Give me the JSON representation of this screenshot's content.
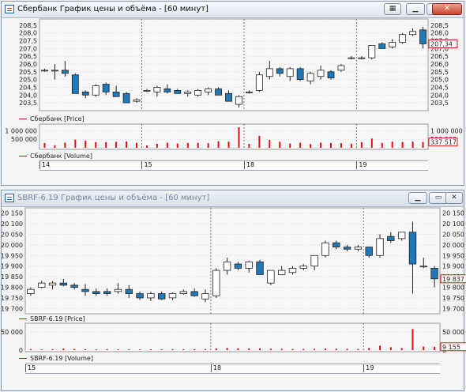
{
  "window1": {
    "title": "Сбербанк График цены и объёма - [60 минут]",
    "price_legend": "Сбербанк [Price]",
    "volume_legend": "Сбербанк [Volume]",
    "price_tag": "207,34",
    "volume_tag": "337 517",
    "price_ticks": [
      "208,5",
      "208,0",
      "207,5",
      "207,0",
      "206,5",
      "206,0",
      "205,5",
      "205,0",
      "204,5",
      "204,0",
      "203,5"
    ],
    "volume_ticks": [
      "1 000 000",
      "500 000"
    ],
    "date_labels": [
      "14",
      "15",
      "18",
      "19"
    ]
  },
  "window2": {
    "title": "SBRF-6.19 График цены и объёма - [60 минут]",
    "price_legend": "SBRF-6.19 [Price]",
    "volume_legend": "SBRF-6.19 [Volume]",
    "price_tag": "19 837",
    "volume_tag": "9 155",
    "price_ticks": [
      "20 150",
      "20 100",
      "20 050",
      "20 000",
      "19 950",
      "19 900",
      "19 850",
      "19 800",
      "19 750",
      "19 700"
    ],
    "volume_ticks": [
      "50 000",
      "0"
    ],
    "date_labels": [
      "15",
      "18",
      "19"
    ]
  },
  "colors": {
    "up": "#ffffff",
    "down": "#1f78b8",
    "volume": "#e01010",
    "grid": "#8a8a8a"
  },
  "chart_data": [
    {
      "type": "candlestick",
      "title": "Сбербанк [Price]",
      "ylim": [
        203.2,
        208.7
      ],
      "grid": true,
      "candles": [
        {
          "o": 205.6,
          "h": 205.7,
          "l": 205.5,
          "c": 205.6
        },
        {
          "o": 205.6,
          "h": 206.0,
          "l": 205.0,
          "c": 205.6
        },
        {
          "o": 205.6,
          "h": 206.2,
          "l": 205.2,
          "c": 205.4
        },
        {
          "o": 205.3,
          "h": 205.4,
          "l": 204.1,
          "c": 204.1
        },
        {
          "o": 204.2,
          "h": 204.3,
          "l": 203.8,
          "c": 204.0
        },
        {
          "o": 204.0,
          "h": 204.7,
          "l": 203.9,
          "c": 204.6
        },
        {
          "o": 204.7,
          "h": 204.8,
          "l": 204.0,
          "c": 204.2
        },
        {
          "o": 204.2,
          "h": 204.6,
          "l": 203.9,
          "c": 203.9
        },
        {
          "o": 204.1,
          "h": 204.2,
          "l": 203.5,
          "c": 203.5
        },
        {
          "o": 203.6,
          "h": 203.8,
          "l": 203.5,
          "c": 203.7
        },
        {
          "o": 204.3,
          "h": 204.4,
          "l": 204.2,
          "c": 204.3
        },
        {
          "o": 204.2,
          "h": 204.6,
          "l": 203.9,
          "c": 204.5
        },
        {
          "o": 204.4,
          "h": 204.7,
          "l": 204.1,
          "c": 204.2
        },
        {
          "o": 204.3,
          "h": 204.4,
          "l": 204.1,
          "c": 204.1
        },
        {
          "o": 204.1,
          "h": 204.3,
          "l": 203.9,
          "c": 204.2
        },
        {
          "o": 204.0,
          "h": 204.4,
          "l": 203.9,
          "c": 204.3
        },
        {
          "o": 204.2,
          "h": 204.5,
          "l": 204.0,
          "c": 204.4
        },
        {
          "o": 204.4,
          "h": 204.5,
          "l": 204.0,
          "c": 204.0
        },
        {
          "o": 204.1,
          "h": 204.3,
          "l": 203.6,
          "c": 203.6
        },
        {
          "o": 203.4,
          "h": 204.0,
          "l": 203.2,
          "c": 203.9
        },
        {
          "o": 204.2,
          "h": 204.3,
          "l": 204.1,
          "c": 204.2
        },
        {
          "o": 204.3,
          "h": 205.5,
          "l": 204.2,
          "c": 205.3
        },
        {
          "o": 205.2,
          "h": 206.2,
          "l": 205.0,
          "c": 205.7
        },
        {
          "o": 205.7,
          "h": 205.8,
          "l": 205.2,
          "c": 205.4
        },
        {
          "o": 205.2,
          "h": 205.8,
          "l": 204.9,
          "c": 205.7
        },
        {
          "o": 205.7,
          "h": 205.8,
          "l": 204.9,
          "c": 205.0
        },
        {
          "o": 204.9,
          "h": 205.5,
          "l": 204.7,
          "c": 205.4
        },
        {
          "o": 205.2,
          "h": 205.9,
          "l": 205.0,
          "c": 205.6
        },
        {
          "o": 205.5,
          "h": 205.6,
          "l": 205.0,
          "c": 205.1
        },
        {
          "o": 205.6,
          "h": 206.0,
          "l": 205.5,
          "c": 205.9
        },
        {
          "o": 206.4,
          "h": 206.5,
          "l": 206.3,
          "c": 206.4
        },
        {
          "o": 206.4,
          "h": 206.5,
          "l": 206.3,
          "c": 206.4
        },
        {
          "o": 206.4,
          "h": 207.2,
          "l": 206.3,
          "c": 207.2
        },
        {
          "o": 207.3,
          "h": 207.4,
          "l": 207.0,
          "c": 207.0
        },
        {
          "o": 207.1,
          "h": 207.6,
          "l": 207.0,
          "c": 207.4
        },
        {
          "o": 207.4,
          "h": 208.0,
          "l": 207.3,
          "c": 207.9
        },
        {
          "o": 207.9,
          "h": 208.3,
          "l": 207.8,
          "c": 208.1
        },
        {
          "o": 208.2,
          "h": 208.4,
          "l": 207.0,
          "c": 207.3
        }
      ],
      "volume": {
        "ylim": [
          0,
          1200000
        ],
        "values": [
          280000,
          150000,
          300000,
          480000,
          420000,
          330000,
          330000,
          350000,
          370000,
          290000,
          140000,
          230000,
          300000,
          250000,
          280000,
          290000,
          270000,
          380000,
          360000,
          1200000,
          230000,
          700000,
          460000,
          350000,
          250000,
          300000,
          220000,
          300000,
          280000,
          270000,
          240000,
          330000,
          540000,
          290000,
          360000,
          340000,
          360000,
          337517
        ]
      }
    },
    {
      "type": "candlestick",
      "title": "SBRF-6.19 [Price]",
      "ylim": [
        19690,
        20160
      ],
      "grid": true,
      "candles": [
        {
          "o": 19770,
          "h": 19800,
          "l": 19760,
          "c": 19790
        },
        {
          "o": 19800,
          "h": 19830,
          "l": 19795,
          "c": 19820
        },
        {
          "o": 19810,
          "h": 19830,
          "l": 19790,
          "c": 19820
        },
        {
          "o": 19820,
          "h": 19840,
          "l": 19805,
          "c": 19810
        },
        {
          "o": 19810,
          "h": 19820,
          "l": 19790,
          "c": 19800
        },
        {
          "o": 19790,
          "h": 19815,
          "l": 19760,
          "c": 19780
        },
        {
          "o": 19780,
          "h": 19795,
          "l": 19760,
          "c": 19770
        },
        {
          "o": 19780,
          "h": 19795,
          "l": 19760,
          "c": 19770
        },
        {
          "o": 19780,
          "h": 19820,
          "l": 19770,
          "c": 19790
        },
        {
          "o": 19790,
          "h": 19810,
          "l": 19750,
          "c": 19770
        },
        {
          "o": 19770,
          "h": 19780,
          "l": 19740,
          "c": 19750
        },
        {
          "o": 19750,
          "h": 19780,
          "l": 19735,
          "c": 19770
        },
        {
          "o": 19770,
          "h": 19780,
          "l": 19740,
          "c": 19745
        },
        {
          "o": 19750,
          "h": 19775,
          "l": 19740,
          "c": 19770
        },
        {
          "o": 19770,
          "h": 19790,
          "l": 19765,
          "c": 19780
        },
        {
          "o": 19780,
          "h": 19795,
          "l": 19755,
          "c": 19760
        },
        {
          "o": 19745,
          "h": 19790,
          "l": 19730,
          "c": 19770
        },
        {
          "o": 19760,
          "h": 19890,
          "l": 19750,
          "c": 19880
        },
        {
          "o": 19880,
          "h": 19940,
          "l": 19860,
          "c": 19920
        },
        {
          "o": 19910,
          "h": 19920,
          "l": 19880,
          "c": 19890
        },
        {
          "o": 19890,
          "h": 19925,
          "l": 19870,
          "c": 19920
        },
        {
          "o": 19920,
          "h": 19930,
          "l": 19860,
          "c": 19860
        },
        {
          "o": 19820,
          "h": 19880,
          "l": 19810,
          "c": 19880
        },
        {
          "o": 19860,
          "h": 19900,
          "l": 19860,
          "c": 19880
        },
        {
          "o": 19870,
          "h": 19900,
          "l": 19860,
          "c": 19890
        },
        {
          "o": 19890,
          "h": 19910,
          "l": 19880,
          "c": 19900
        },
        {
          "o": 19900,
          "h": 19950,
          "l": 19880,
          "c": 19950
        },
        {
          "o": 19950,
          "h": 20020,
          "l": 19940,
          "c": 20010
        },
        {
          "o": 20010,
          "h": 20020,
          "l": 19980,
          "c": 19990
        },
        {
          "o": 19990,
          "h": 20000,
          "l": 19970,
          "c": 19980
        },
        {
          "o": 19980,
          "h": 20000,
          "l": 19970,
          "c": 19990
        },
        {
          "o": 19990,
          "h": 19990,
          "l": 19940,
          "c": 19950
        },
        {
          "o": 19950,
          "h": 20050,
          "l": 19940,
          "c": 20030
        },
        {
          "o": 20040,
          "h": 20060,
          "l": 20010,
          "c": 20020
        },
        {
          "o": 20030,
          "h": 20060,
          "l": 20020,
          "c": 20060
        },
        {
          "o": 20060,
          "h": 20110,
          "l": 19770,
          "c": 19910
        },
        {
          "o": 19900,
          "h": 19940,
          "l": 19890,
          "c": 19900
        },
        {
          "o": 19890,
          "h": 19900,
          "l": 19800,
          "c": 19840
        }
      ],
      "volume": {
        "ylim": [
          0,
          65000
        ],
        "values": [
          3000,
          2000,
          2500,
          4500,
          3000,
          2500,
          2000,
          2500,
          2000,
          2000,
          1800,
          2200,
          2000,
          2500,
          2200,
          2300,
          2800,
          5000,
          6000,
          5000,
          4500,
          5000,
          4000,
          3500,
          3200,
          3000,
          3500,
          4500,
          4000,
          3500,
          3000,
          6000,
          12000,
          8000,
          6000,
          58000,
          10000,
          9155
        ]
      }
    }
  ]
}
